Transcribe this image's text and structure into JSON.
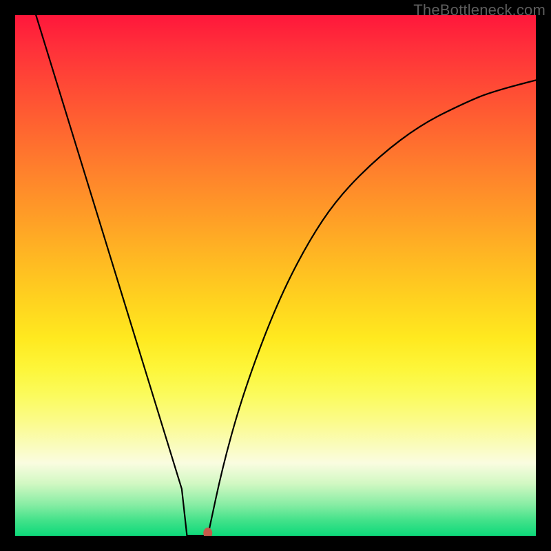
{
  "watermark": {
    "text": "TheBottleneck.com"
  },
  "chart_data": {
    "type": "line",
    "title": "",
    "xlabel": "",
    "ylabel": "",
    "xlim": [
      0,
      100
    ],
    "ylim": [
      0,
      100
    ],
    "grid": false,
    "legend": false,
    "series": [
      {
        "name": "curve",
        "color": "#000000",
        "x": [
          4,
          8,
          12,
          16,
          20,
          24,
          28,
          32,
          33,
          37,
          40,
          44,
          50,
          56,
          62,
          70,
          78,
          86,
          92,
          100
        ],
        "values": [
          100,
          87,
          74,
          61,
          48,
          35,
          22,
          9,
          0,
          0,
          14,
          28,
          44,
          56,
          65,
          73,
          79,
          83,
          85.5,
          87.5
        ]
      }
    ],
    "floor_segment": {
      "x0": 33,
      "x1": 37,
      "y": 0
    },
    "marker": {
      "x": 37,
      "y": 0,
      "rx": 6.5,
      "ry": 8,
      "color": "#c65a4a"
    }
  },
  "colors": {
    "background": "#000000",
    "gradient_top": "#ff173b",
    "gradient_bottom": "#0dd97a",
    "watermark": "#5e5e5e"
  }
}
